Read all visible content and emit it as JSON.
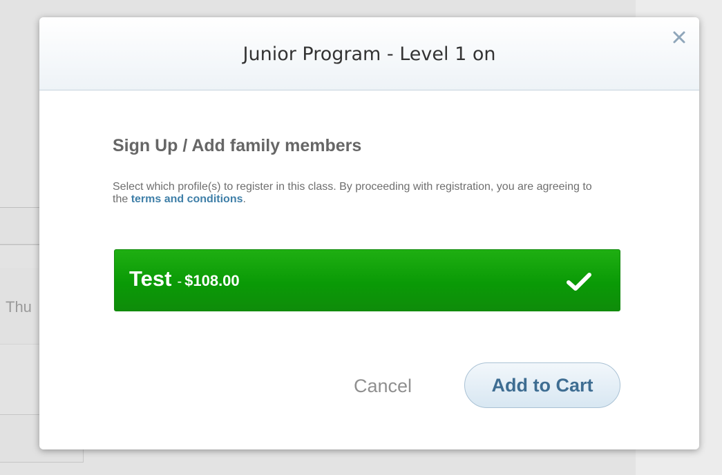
{
  "background": {
    "row_text": "Thu"
  },
  "modal": {
    "title": "Junior Program - Level 1 on",
    "close_icon": "close-icon",
    "section_heading": "Sign Up / Add family members",
    "description_prefix": "Select which profile(s) to register in this class. By proceeding with registration, you are agreeing to the ",
    "terms_link": "terms and conditions",
    "description_suffix": ".",
    "profiles": [
      {
        "name": "Test",
        "separator": "-",
        "price": "$108.00",
        "selected": true,
        "check_icon": "check-icon"
      }
    ],
    "cancel_label": "Cancel",
    "add_to_cart_label": "Add to Cart"
  },
  "colors": {
    "selected_profile": "#0a9a06",
    "link": "#3f7fa8",
    "primary_button_text": "#3e6d92"
  }
}
